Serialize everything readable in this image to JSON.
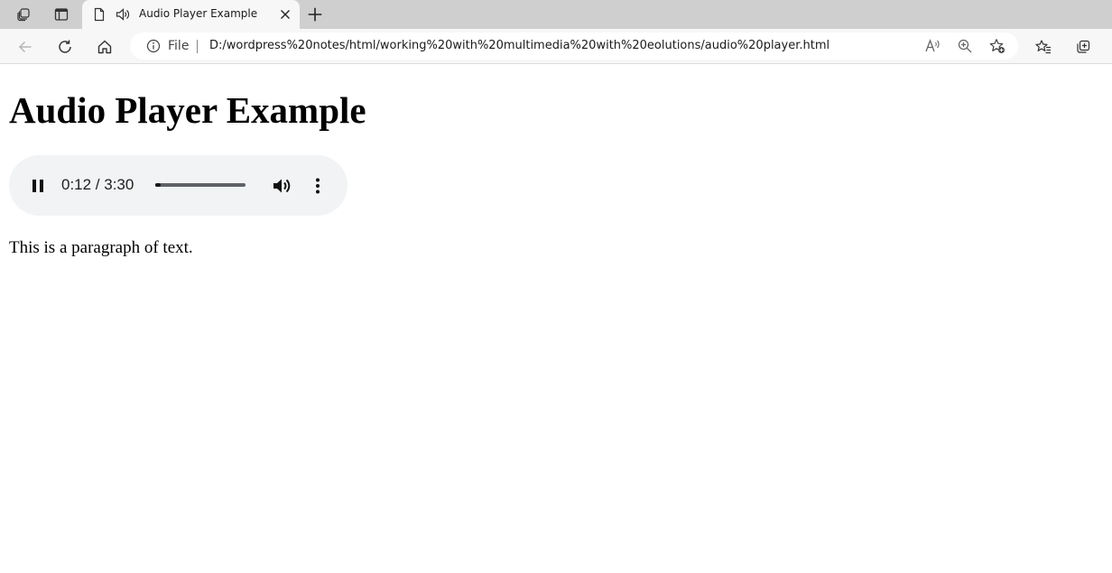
{
  "browser": {
    "tab": {
      "title": "Audio Player Example"
    },
    "address_bar": {
      "scheme_label": "File",
      "url": "D:/wordpress%20notes/html/working%20with%20multimedia%20with%20eolutions/audio%20player.html"
    }
  },
  "page": {
    "heading": "Audio Player Example",
    "audio_player": {
      "time_display": "0:12 / 3:30",
      "progress_fraction": 0.057,
      "state": "playing"
    },
    "paragraph": "This is a paragraph of text."
  },
  "icons": {
    "tab_strip": [
      "workspaces-icon",
      "vertical-tabs-icon",
      "page-icon",
      "speaker-icon",
      "close-icon",
      "new-tab-icon"
    ],
    "toolbar": [
      "back-icon",
      "refresh-icon",
      "home-icon",
      "info-icon",
      "read-aloud-icon",
      "zoom-icon",
      "add-favorite-icon",
      "favorites-icon",
      "collections-icon"
    ],
    "player": [
      "pause-icon",
      "volume-icon",
      "more-options-icon"
    ]
  },
  "colors": {
    "tab_strip_bg": "#cfcfcf",
    "toolbar_bg": "#f7f7f7",
    "player_bg": "#f1f3f4"
  }
}
